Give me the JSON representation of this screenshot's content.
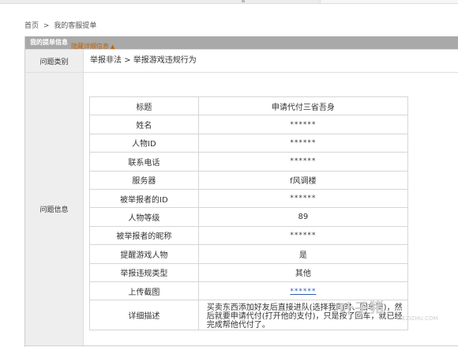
{
  "breadcrumb": {
    "home": "首页",
    "sep": ">",
    "current": "我的客服提单"
  },
  "panel": {
    "title": "我的提单信息"
  },
  "category": {
    "label": "问题类别",
    "value": "举报非法 > 举报游戏违规行为"
  },
  "info": {
    "label": "问题信息",
    "toggle_label": "隐藏详细信息",
    "toggle_icon": "caret-up-icon",
    "rows": [
      {
        "key": "标题",
        "value": "申请代付三省吾身"
      },
      {
        "key": "姓名",
        "value": "******"
      },
      {
        "key": "人物ID",
        "value": "******"
      },
      {
        "key": "联系电话",
        "value": "******"
      },
      {
        "key": "服务器",
        "value": "f风调楼"
      },
      {
        "key": "被举报者的ID",
        "value": "******"
      },
      {
        "key": "人物等级",
        "value": "89"
      },
      {
        "key": "被举报者的昵称",
        "value": "******"
      },
      {
        "key": "提醒游戏人物",
        "value": "是"
      },
      {
        "key": "举报违规类型",
        "value": "其他"
      },
      {
        "key": "上传截图",
        "value": "******"
      },
      {
        "key": "详细描述",
        "value": "买卖东西添加好友后直接进队(选择我同时、回车键)，然后就要申请代付(打开他的支付)，只是按了回车，就已经完成帮他代付了。"
      }
    ]
  },
  "watermark": {
    "text": "叶子猪",
    "sub": "YEZIZHU.COM"
  }
}
